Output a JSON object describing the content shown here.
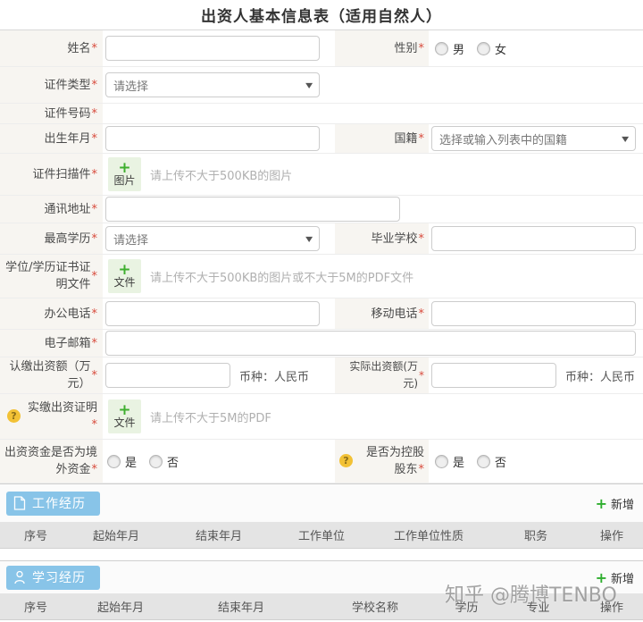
{
  "title": "出资人基本信息表（适用自然人）",
  "required_mark": "*",
  "options": {
    "male": "男",
    "female": "女",
    "yes": "是",
    "no": "否"
  },
  "currency_note": "币种：人民币",
  "question_mark": "?",
  "caret": "▼",
  "fields": {
    "name": "姓名",
    "gender": "性别",
    "cert_type": "证件类型",
    "cert_type_placeholder": "请选择",
    "cert_number": "证件号码",
    "birth_date": "出生年月",
    "nationality": "国籍",
    "nationality_placeholder": "选择或输入列表中的国籍",
    "cert_scan": "证件扫描件",
    "cert_scan_hint": "请上传不大于500KB的图片",
    "address": "通讯地址",
    "education": "最高学历",
    "education_placeholder": "请选择",
    "school": "毕业学校",
    "degree_files": "学位/学历证书证明文件",
    "degree_files_hint": "请上传不大于500KB的图片或不大于5M的PDF文件",
    "office_phone": "办公电话",
    "mobile_phone": "移动电话",
    "email": "电子邮箱",
    "subscribed_capital": "认缴出资额（万元）",
    "actual_capital": "实际出资额(万元)",
    "paid_proof": "实缴出资证明",
    "paid_proof_hint": "请上传不大于5M的PDF",
    "foreign_funds": "出资资金是否为境外资金",
    "controlling_shareholder": "是否为控股股东"
  },
  "upload": {
    "plus": "+",
    "image_label": "图片",
    "file_label": "文件"
  },
  "sections": [
    {
      "title": "工作经历",
      "add_plus": "+",
      "add_label": "新增",
      "columns": [
        "序号",
        "起始年月",
        "结束年月",
        "工作单位",
        "工作单位性质",
        "职务",
        "操作"
      ]
    },
    {
      "title": "学习经历",
      "add_plus": "+",
      "add_label": "新增",
      "columns": [
        "序号",
        "起始年月",
        "结束年月",
        "学校名称",
        "学历",
        "专业",
        "操作"
      ]
    }
  ],
  "watermark": "知乎 @腾博TENBO",
  "colors": {
    "accent_blue": "#88c4e8",
    "accent_green": "#3eaf2e",
    "required_red": "#d84a3c",
    "warn_yellow": "#f2c135"
  }
}
